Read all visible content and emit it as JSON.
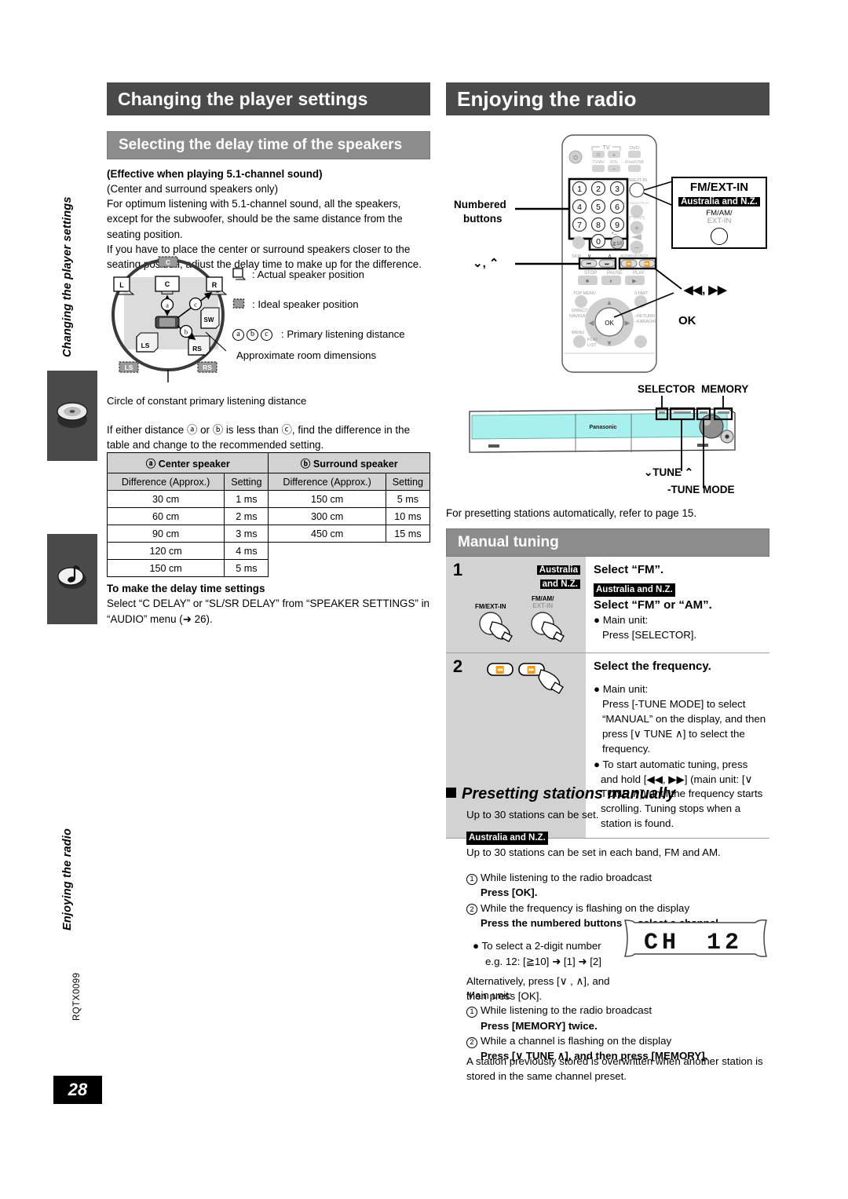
{
  "footer": {
    "code": "RQTX0099",
    "page_number": "28"
  },
  "side_rail": {
    "label_settings": "Changing the player settings",
    "label_radio": "Enjoying the radio",
    "tab_disc_icon": "disc-icon",
    "tab_music_icon": "music-note-icon"
  },
  "left": {
    "chapter_title": "Changing the player settings",
    "section_title": "Selecting the delay time of the speakers",
    "intro_bold": "(Effective when playing 5.1-channel sound)",
    "intro_line2": "(Center and surround speakers only)",
    "intro_para1": "For optimum listening with 5.1-channel sound, all the speakers, except for the subwoofer, should be the same distance from the seating position.",
    "intro_para2": "If you have to place the center or surround speakers closer to the seating position, adjust the delay time to make up for the difference.",
    "diagram": {
      "speakers": [
        "L",
        "C",
        "R",
        "LS",
        "RS",
        "SW"
      ],
      "ideal_speakers": [
        "C",
        "LS",
        "RS"
      ],
      "distance_markers": [
        "a",
        "b",
        "c"
      ],
      "legend": [
        {
          "icon": "actual-speaker-icon",
          "text": ": Actual speaker position"
        },
        {
          "icon": "ideal-speaker-icon",
          "text": ": Ideal speaker position"
        },
        {
          "icon": "distance-letters-icon",
          "text": ": Primary listening distance"
        }
      ],
      "room_caption": "Approximate room dimensions",
      "circle_caption": "Circle of constant primary listening distance"
    },
    "table_intro": "If either distance ⓐ or ⓑ is less than ⓒ, find the difference in the table and change to the recommended setting.",
    "table": {
      "group_headers": [
        "ⓐ Center speaker",
        "ⓑ Surround speaker"
      ],
      "sub_headers": [
        "Difference (Approx.)",
        "Setting",
        "Difference (Approx.)",
        "Setting"
      ],
      "rows": [
        [
          "30 cm",
          "1 ms",
          "150 cm",
          "5 ms"
        ],
        [
          "60 cm",
          "2 ms",
          "300 cm",
          "10 ms"
        ],
        [
          "90 cm",
          "3 ms",
          "450 cm",
          "15 ms"
        ],
        [
          "120 cm",
          "4 ms",
          "",
          ""
        ],
        [
          "150 cm",
          "5 ms",
          "",
          ""
        ]
      ]
    },
    "note_title": "To make the delay time settings",
    "note_body": "Select “C DELAY” or “SL/SR DELAY” from “SPEAKER SETTINGS” in “AUDIO” menu (➜ 26)."
  },
  "right": {
    "chapter_title": "Enjoying the radio",
    "remote": {
      "callout_numbered": "Numbered\nbuttons",
      "callout_numbered_l1": "Numbered",
      "callout_numbered_l2": "buttons",
      "callout_updown": "⌄, ⌃",
      "callout_skip": "◀◀, ▶▶",
      "callout_ok": "OK",
      "keys": [
        "1",
        "2",
        "3",
        "4",
        "5",
        "6",
        "7",
        "8",
        "9",
        "0",
        "≧10"
      ],
      "tv_group": "TV",
      "tv_labels": [
        "TV/AV",
        "VOL"
      ],
      "dvd_label": "DVD",
      "ipod_label": "iPod/USB",
      "fmext_label": "FM/EXT-IN",
      "onetouch_label": "1 TOUCH PLAY",
      "vol_label": "VOL",
      "transport_labels": [
        "STOP",
        "PAUSE",
        "PLAY"
      ],
      "skip_label": "SKIP",
      "slow_search_label": "SLOW/SEARCH",
      "menu_labels": [
        "TOP MENU",
        "DIRECT NAVIGATOR",
        "START",
        "MENU",
        "PLAY LIST",
        "–RETURN –KARAOKE"
      ],
      "ok_key": "OK"
    },
    "fm_ext_box": {
      "title": "FM/EXT-IN",
      "region_tag": "Australia and N.Z.",
      "sub_line1": "FM/AM/",
      "sub_line2": "EXT-IN"
    },
    "unit": {
      "brand": "Panasonic",
      "callout_selector": "SELECTOR",
      "callout_memory": "MEMORY",
      "callout_tune": "⌄TUNE ⌃",
      "callout_tune_mode": "-TUNE MODE"
    },
    "auto_preset_note": "For presetting stations automatically, refer to page 15.",
    "section_title": "Manual tuning",
    "steps": [
      {
        "num": "1",
        "fig_tag_line1": "Australia",
        "fig_tag_line2": "and N.Z.",
        "fig_label_left": "FM/EXT-IN",
        "fig_label_right_1": "FM/AM/",
        "fig_label_right_2": "EXT-IN",
        "title": "Select “FM”.",
        "region_tag": "Australia and N.Z.",
        "title2": "Select “FM” or “AM”.",
        "bullets": [
          "● Main unit:",
          "Press [SELECTOR]."
        ]
      },
      {
        "num": "2",
        "fig_btn_1": "◀◀",
        "fig_btn_2": "▶▶",
        "title": "Select the frequency.",
        "bullets": [
          "● Main unit:",
          "Press [-TUNE MODE] to select “MANUAL” on the display, and then press [∨ TUNE ∧] to select the frequency.",
          "● To start automatic tuning, press and hold [◀◀, ▶▶] (main unit: [∨ TUNE ∧]) until the frequency starts scrolling. Tuning stops when a station is found."
        ]
      }
    ],
    "preset": {
      "heading": "Presetting stations manually",
      "line1": "Up to 30 stations can be set.",
      "region_tag": "Australia and N.Z.",
      "line2": "Up to 30 stations can be set in each band, FM and AM.",
      "step1_num": "①",
      "step1_text": "While listening to the radio broadcast",
      "step1_bold": "Press [OK].",
      "step2_num": "②",
      "step2_text": "While the frequency is flashing on the display",
      "step2_bold": "Press the numbered buttons to select a channel.",
      "bullet_2digit_l1": "● To select a 2-digit number",
      "bullet_2digit_l2": "e.g. 12: [≧10] ➜ [1] ➜ [2]",
      "alt_l1": "Alternatively, press [∨ , ∧], and",
      "alt_l2": "then press [OK].",
      "display_text": "CH  12",
      "main_unit_label": "Main unit:",
      "mu_step1_num": "①",
      "mu_step1_text": "While listening to the radio broadcast",
      "mu_step1_bold": "Press [MEMORY] twice.",
      "mu_step2_num": "②",
      "mu_step2_text": "While a channel is flashing on the display",
      "mu_step2_bold": "Press [∨ TUNE ∧], and then press [MEMORY].",
      "closing": "A station previously stored is overwritten when another station is stored in the same channel preset."
    }
  },
  "colors": {
    "chapter_bar": "#4a4a4a",
    "section_bar": "#8c8c8c",
    "table_header": "#d2d2d2",
    "unit_front": "#a8f0ee",
    "step_fig_bg": "#d2d2d2"
  }
}
